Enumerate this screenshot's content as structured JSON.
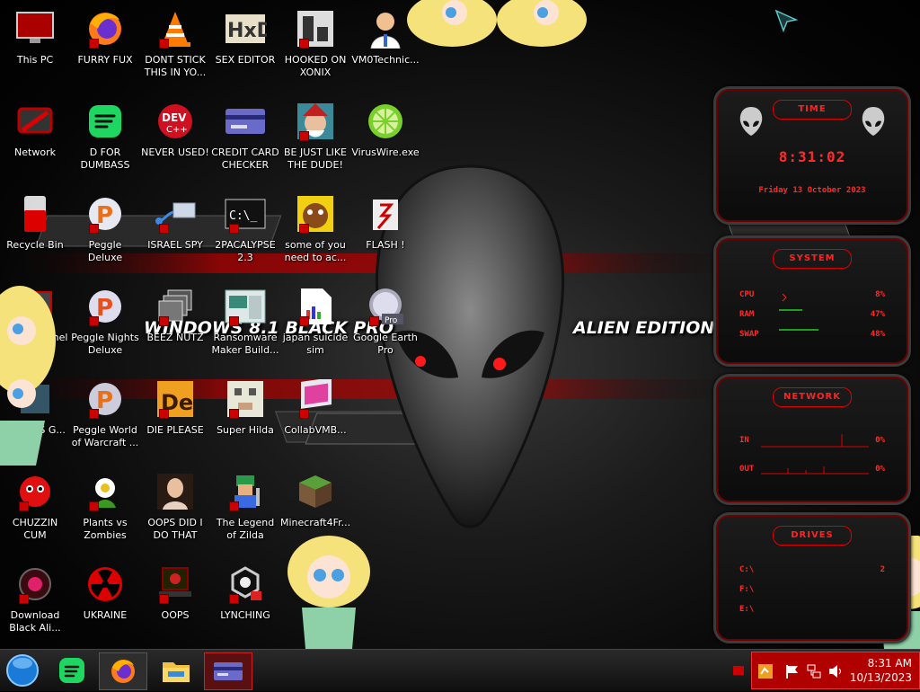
{
  "wallpaper": {
    "left_text": "WINDOWS 8.1 BLACK PRO",
    "right_text": "ALIEN EDITION 20"
  },
  "desktop_icons": [
    {
      "label": "This PC",
      "icon": "monitor-icon"
    },
    {
      "label": "FURRY FUX",
      "icon": "firefox-icon"
    },
    {
      "label": "DONT STICK THIS IN YO...",
      "icon": "vlc-cone-icon"
    },
    {
      "label": "SEX EDITOR",
      "icon": "hex-editor-icon"
    },
    {
      "label": "HOOKED ON XONIX",
      "icon": "xonix-icon"
    },
    {
      "label": "VM0Technic...",
      "icon": "doctor-icon"
    },
    {
      "label": "Network",
      "icon": "network-icon"
    },
    {
      "label": "D FOR DUMBASS",
      "icon": "spotify-icon"
    },
    {
      "label": "NEVER USED!",
      "icon": "dev-cpp-icon"
    },
    {
      "label": "CREDIT CARD CHECKER",
      "icon": "credit-card-icon"
    },
    {
      "label": "BE JUST LIKE THE DUDE!",
      "icon": "elf-icon"
    },
    {
      "label": "VirusWire.exe",
      "icon": "lime-icon"
    },
    {
      "label": "Recycle Bin",
      "icon": "recycle-bin-icon"
    },
    {
      "label": "Peggle Deluxe",
      "icon": "peggle-icon"
    },
    {
      "label": "ISRAEL SPY",
      "icon": "spy-cable-icon"
    },
    {
      "label": "2PACALYPSE 2.3",
      "icon": "terminal-icon"
    },
    {
      "label": "some of you need to ac...",
      "icon": "dog-icon"
    },
    {
      "label": "FLASH !",
      "icon": "flash-icon"
    },
    {
      "label": "Control Panel",
      "icon": "control-panel-icon"
    },
    {
      "label": "Peggle Nights Deluxe",
      "icon": "peggle-icon"
    },
    {
      "label": "BEEZ NUTZ",
      "icon": "windows-stack-icon"
    },
    {
      "label": "Ransomware Maker Build...",
      "icon": "ransomware-icon"
    },
    {
      "label": "japan suicide sim",
      "icon": "document-icon"
    },
    {
      "label": "Google Earth Pro",
      "icon": "google-earth-icon"
    },
    {
      "label": "STS WIS G...",
      "icon": "sts-icon"
    },
    {
      "label": "Peggle World of Warcraft ...",
      "icon": "peggle-icon"
    },
    {
      "label": "DIE PLEASE",
      "icon": "director-icon"
    },
    {
      "label": "Super Hilda",
      "icon": "pixel-dog-icon"
    },
    {
      "label": "CollabVMB...",
      "icon": "collabvm-icon"
    },
    {
      "label": "CHUZZIN CUM",
      "icon": "chuzzle-icon"
    },
    {
      "label": "Plants vs Zombies",
      "icon": "pvz-icon"
    },
    {
      "label": "OOPS DID I DO THAT",
      "icon": "portrait-icon"
    },
    {
      "label": "The Legend of Zilda",
      "icon": "pixel-hero-icon"
    },
    {
      "label": "Minecraft4Fr...",
      "icon": "minecraft-icon"
    },
    {
      "label": "Download Black Ali...",
      "icon": "alien-icon"
    },
    {
      "label": "UKRAINE",
      "icon": "radiation-icon"
    },
    {
      "label": "OOPS",
      "icon": "laptop-icon"
    },
    {
      "label": "LYNCHING",
      "icon": "cloud-network-icon"
    }
  ],
  "widgets": {
    "time": {
      "title": "TIME",
      "clock": "8:31:02",
      "date": "Friday 13 October 2023"
    },
    "system": {
      "title": "SYSTEM",
      "rows": [
        {
          "label": "CPU",
          "value": "8%"
        },
        {
          "label": "RAM",
          "value": "47%"
        },
        {
          "label": "SWAP",
          "value": "48%"
        }
      ]
    },
    "network": {
      "title": "NETWORK",
      "rows": [
        {
          "label": "IN",
          "value": "0%"
        },
        {
          "label": "OUT",
          "value": "0%"
        }
      ]
    },
    "drives": {
      "title": "DRIVES",
      "rows": [
        {
          "label": "C:\\",
          "value": "2"
        },
        {
          "label": "F:\\",
          "value": ""
        },
        {
          "label": "E:\\",
          "value": ""
        }
      ]
    }
  },
  "taskbar": {
    "buttons": [
      {
        "icon": "start-orb-icon"
      },
      {
        "icon": "spotify-icon"
      },
      {
        "icon": "firefox-icon"
      },
      {
        "icon": "file-explorer-icon"
      },
      {
        "icon": "credit-card-icon"
      }
    ],
    "clock_time": "8:31 AM",
    "clock_date": "10/13/2023"
  },
  "colors": {
    "accent": "#d40000",
    "tray": "#b00000"
  }
}
